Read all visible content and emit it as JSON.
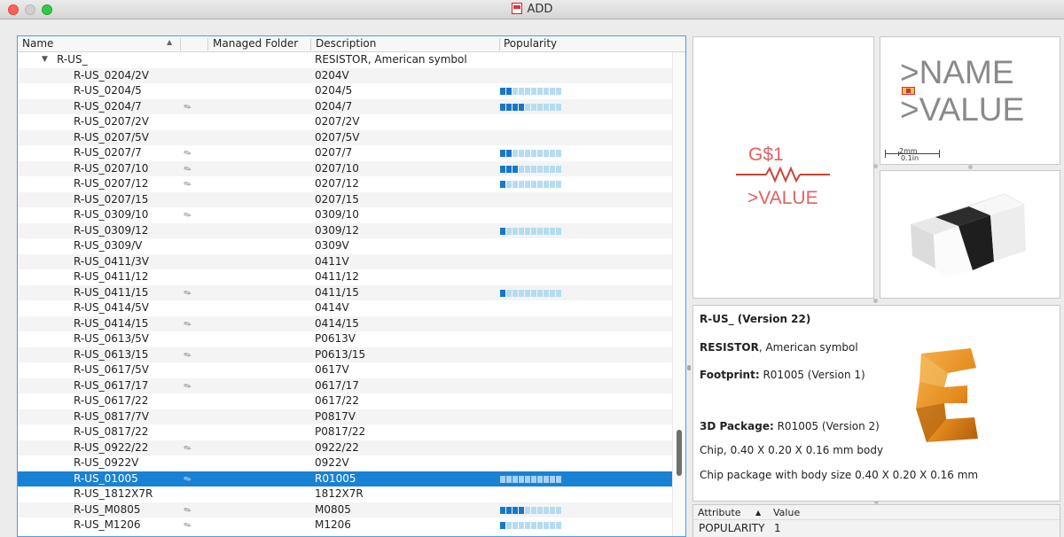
{
  "window": {
    "title": "ADD"
  },
  "table": {
    "headers": {
      "name": "Name",
      "folder": "Managed Folder",
      "description": "Description",
      "popularity": "Popularity"
    },
    "group": {
      "name": "R-US_",
      "description": "RESISTOR, American symbol"
    },
    "rows": [
      {
        "name": "R-US_0204/2V",
        "managed": false,
        "description": "0204V",
        "popularity": 0
      },
      {
        "name": "R-US_0204/5",
        "managed": false,
        "description": "0204/5",
        "popularity": 2
      },
      {
        "name": "R-US_0204/7",
        "managed": true,
        "description": "0204/7",
        "popularity": 4
      },
      {
        "name": "R-US_0207/2V",
        "managed": false,
        "description": "0207/2V",
        "popularity": 0
      },
      {
        "name": "R-US_0207/5V",
        "managed": false,
        "description": "0207/5V",
        "popularity": 0
      },
      {
        "name": "R-US_0207/7",
        "managed": true,
        "description": "0207/7",
        "popularity": 2
      },
      {
        "name": "R-US_0207/10",
        "managed": true,
        "description": "0207/10",
        "popularity": 3
      },
      {
        "name": "R-US_0207/12",
        "managed": true,
        "description": "0207/12",
        "popularity": 1
      },
      {
        "name": "R-US_0207/15",
        "managed": false,
        "description": "0207/15",
        "popularity": 0
      },
      {
        "name": "R-US_0309/10",
        "managed": true,
        "description": "0309/10",
        "popularity": 0
      },
      {
        "name": "R-US_0309/12",
        "managed": false,
        "description": "0309/12",
        "popularity": 1
      },
      {
        "name": "R-US_0309/V",
        "managed": false,
        "description": "0309V",
        "popularity": 0
      },
      {
        "name": "R-US_0411/3V",
        "managed": false,
        "description": "0411V",
        "popularity": 0
      },
      {
        "name": "R-US_0411/12",
        "managed": false,
        "description": "0411/12",
        "popularity": 0
      },
      {
        "name": "R-US_0411/15",
        "managed": true,
        "description": "0411/15",
        "popularity": 1
      },
      {
        "name": "R-US_0414/5V",
        "managed": false,
        "description": "0414V",
        "popularity": 0
      },
      {
        "name": "R-US_0414/15",
        "managed": true,
        "description": "0414/15",
        "popularity": 0
      },
      {
        "name": "R-US_0613/5V",
        "managed": false,
        "description": "P0613V",
        "popularity": 0
      },
      {
        "name": "R-US_0613/15",
        "managed": true,
        "description": "P0613/15",
        "popularity": 0
      },
      {
        "name": "R-US_0617/5V",
        "managed": false,
        "description": "0617V",
        "popularity": 0
      },
      {
        "name": "R-US_0617/17",
        "managed": true,
        "description": "0617/17",
        "popularity": 0
      },
      {
        "name": "R-US_0617/22",
        "managed": false,
        "description": "0617/22",
        "popularity": 0
      },
      {
        "name": "R-US_0817/7V",
        "managed": false,
        "description": "P0817V",
        "popularity": 0
      },
      {
        "name": "R-US_0817/22",
        "managed": false,
        "description": "P0817/22",
        "popularity": 0
      },
      {
        "name": "R-US_0922/22",
        "managed": true,
        "description": "0922/22",
        "popularity": 0
      },
      {
        "name": "R-US_0922V",
        "managed": false,
        "description": "0922V",
        "popularity": 0
      },
      {
        "name": "R-US_01005",
        "managed": true,
        "description": "R01005",
        "popularity": 0,
        "selected": true
      },
      {
        "name": "R-US_1812X7R",
        "managed": false,
        "description": "1812X7R",
        "popularity": 0
      },
      {
        "name": "R-US_M0805",
        "managed": true,
        "description": "M0805",
        "popularity": 4
      },
      {
        "name": "R-US_M1206",
        "managed": true,
        "description": "M1206",
        "popularity": 1
      }
    ],
    "popularity_max": 10,
    "popularity_on_color": "#1877c9",
    "popularity_off_color": "#b5dcf3"
  },
  "symbol_preview": {
    "name": "G$1",
    "value": ">VALUE"
  },
  "package_preview": {
    "name": ">NAME",
    "value": ">VALUE",
    "scale_top": "2mm",
    "scale_bottom": "0.1in"
  },
  "details": {
    "title": "R-US_ (Version 22)",
    "desc_bold": "RESISTOR",
    "desc_rest": ", American symbol",
    "footprint_label": "Footprint:",
    "footprint_value": " R01005 (Version 1)",
    "package_label": "3D Package:",
    "package_value": " R01005 (Version 2)",
    "line1": "Chip, 0.40 X 0.20 X 0.16 mm body",
    "line2": "Chip package with body size 0.40 X 0.20 X 0.16 mm"
  },
  "attributes": {
    "header_attribute": "Attribute",
    "header_value": "Value",
    "rows": [
      {
        "name": "POPULARITY",
        "value": "1"
      }
    ]
  }
}
